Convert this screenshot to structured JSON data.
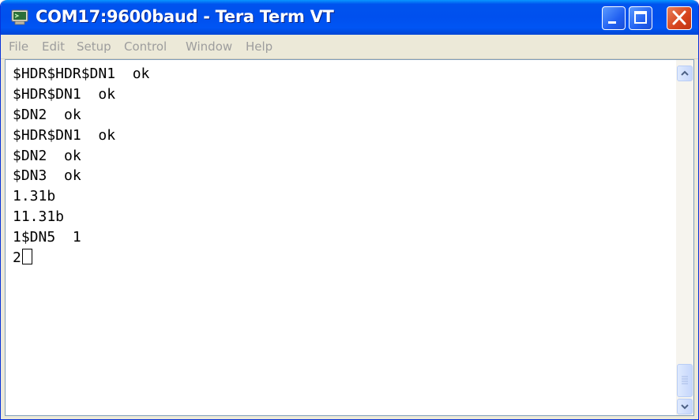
{
  "window": {
    "title": "COM17:9600baud - Tera Term VT",
    "icon": "tera-term-app-icon"
  },
  "title_buttons": {
    "minimize_icon": "minimize-icon",
    "maximize_icon": "maximize-icon",
    "close_icon": "close-icon"
  },
  "menu": {
    "items": [
      {
        "label": "File"
      },
      {
        "label": "Edit"
      },
      {
        "label": "Setup"
      },
      {
        "label": "Control"
      },
      {
        "label": "Window"
      },
      {
        "label": "Help"
      }
    ]
  },
  "terminal": {
    "lines": [
      "$HDR$HDR$DN1  ok",
      "$HDR$DN1  ok",
      "$DN2  ok",
      "$HDR$DN1  ok",
      "$DN2  ok",
      "$DN3  ok",
      "1.31b",
      "11.31b",
      "1$DN5  1",
      "2"
    ]
  },
  "scrollbar": {
    "up_icon": "scroll-up-arrow-icon",
    "down_icon": "scroll-down-arrow-icon",
    "thumb_icon": "scroll-thumb-grip-icon"
  },
  "colors": {
    "titlebar": "#0055ea",
    "close_button": "#d6431d",
    "menu_disabled_text": "#9d9d9d",
    "terminal_bg": "#ffffff",
    "terminal_text": "#000000"
  }
}
